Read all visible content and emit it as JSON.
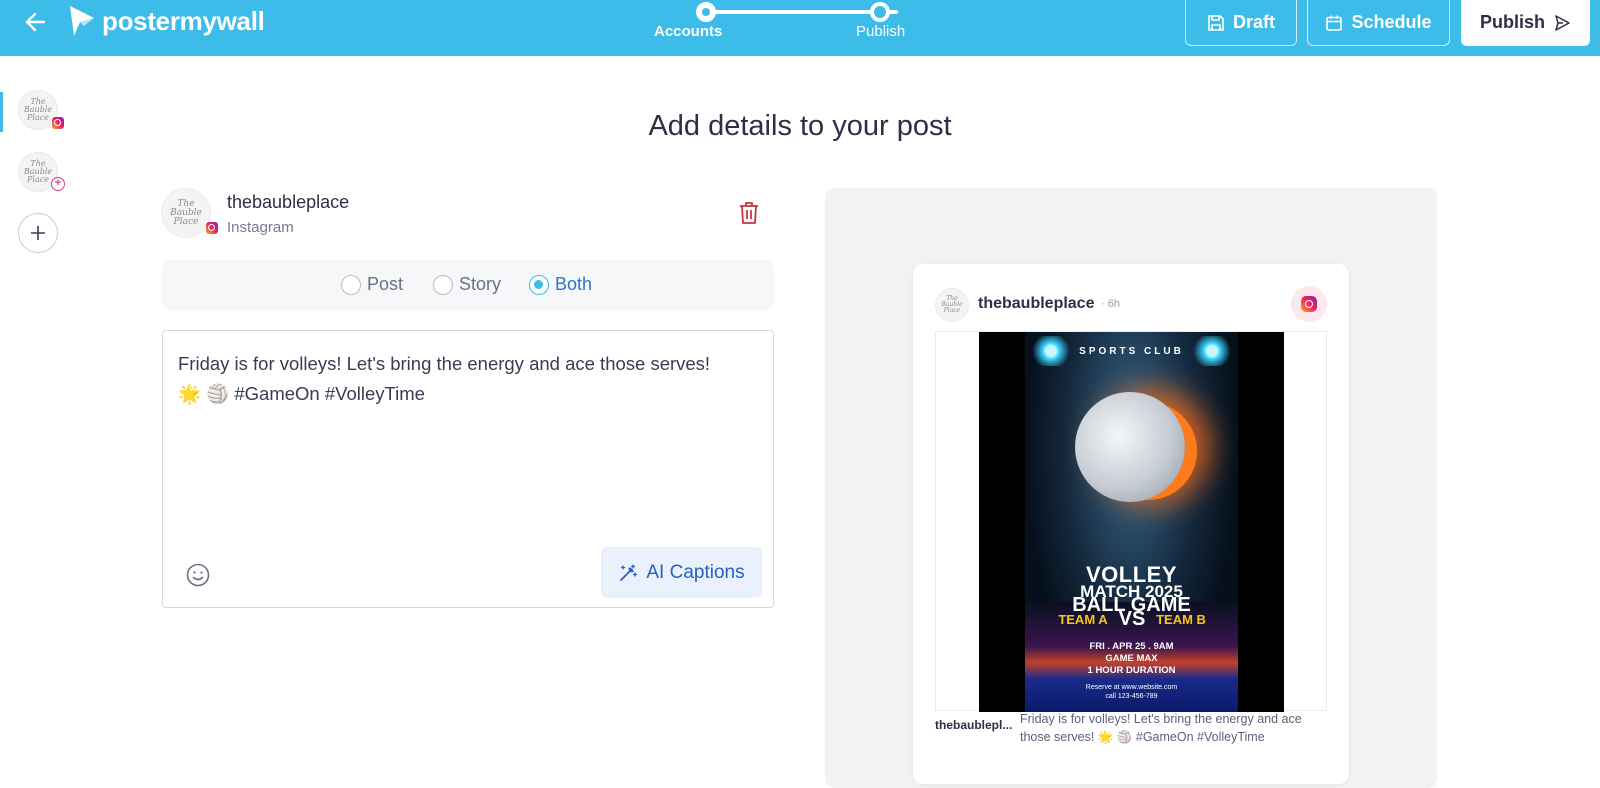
{
  "header": {
    "logo_text": "postermywall",
    "steps": [
      {
        "label": "Accounts",
        "state": "current"
      },
      {
        "label": "Publish",
        "state": "upcoming"
      }
    ],
    "draft_label": "Draft",
    "schedule_label": "Schedule",
    "publish_label": "Publish",
    "bg_color": "#3dbbe9"
  },
  "page": {
    "title": "Add details to your post"
  },
  "account": {
    "name": "thebaubleplace",
    "network": "Instagram",
    "avatar_text": "The Bauble Place"
  },
  "post_type": {
    "options": [
      "Post",
      "Story",
      "Both"
    ],
    "selected": "Both"
  },
  "caption": {
    "text": "Friday is for volleys! Let's bring the energy and ace those serves!\n🌟 🏐 #GameOn #VolleyTime",
    "ai_button_label": "AI Captions"
  },
  "preview": {
    "username": "thebaubleplace",
    "time": "· 6h",
    "footer_user": "thebaublepl...",
    "footer_caption": "Friday is for volleys! Let's bring the energy and ace those serves! 🌟 🏐 #GameOn #VolleyTime",
    "poster": {
      "club": "SPORTS CLUB",
      "title_1": "VOLLEY",
      "title_2": "MATCH 2025",
      "title_3": "BALL GAME",
      "team_a": "TEAM A",
      "vs": "VS",
      "team_b": "TEAM B",
      "date": "FRI . APR 25 . 9AM",
      "venue": "GAME MAX",
      "duration": "1 HOUR DURATION",
      "reserve": "Reserve at www.website.com",
      "call": "call 123-456-789"
    }
  }
}
